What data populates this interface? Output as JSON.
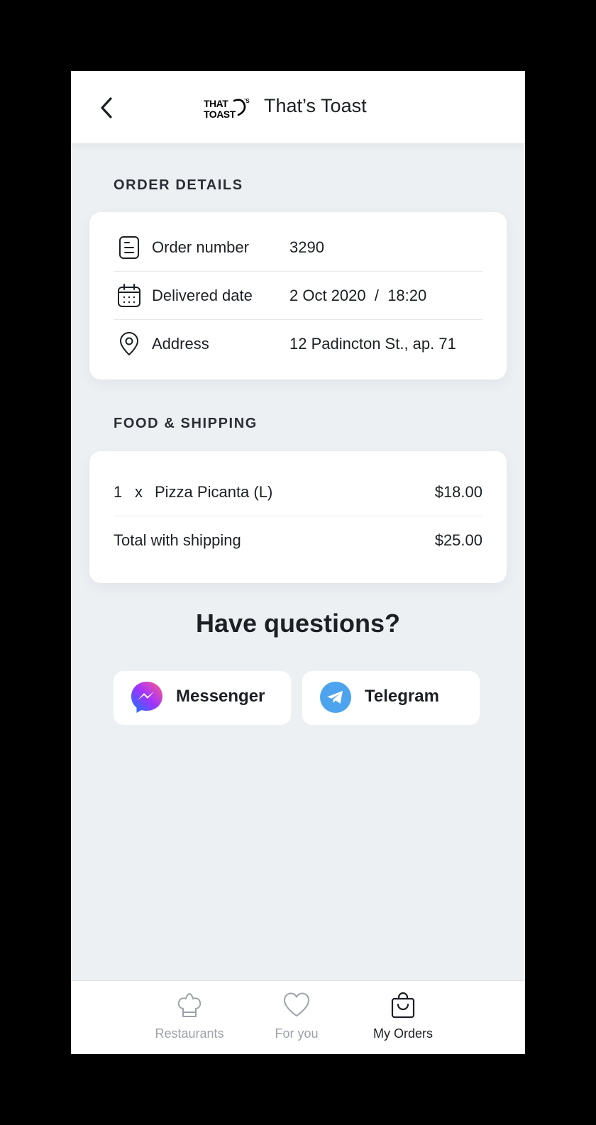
{
  "header": {
    "back_icon": "chevron-left-icon",
    "logo_text": "THAT'S TOAST",
    "title": "That’s Toast"
  },
  "order_details": {
    "section_title": "ORDER DETAILS",
    "rows": [
      {
        "icon": "receipt-icon",
        "label": "Order number",
        "value": "3290"
      },
      {
        "icon": "calendar-icon",
        "label": "Delivered date",
        "value": "2 Oct 2020  /  18:20"
      },
      {
        "icon": "location-pin-icon",
        "label": "Address",
        "value": "12 Padincton St., ap. 71"
      }
    ]
  },
  "food_shipping": {
    "section_title": "FOOD & SHIPPING",
    "items": [
      {
        "qty": "1",
        "x": "x",
        "name": "Pizza Picanta (L)",
        "price": "$18.00"
      }
    ],
    "total_label": "Total with shipping",
    "total_value": "$25.00"
  },
  "questions": {
    "title": "Have questions?",
    "buttons": [
      {
        "icon": "messenger-icon",
        "label": "Messenger"
      },
      {
        "icon": "telegram-icon",
        "label": "Telegram"
      }
    ]
  },
  "tabbar": {
    "tabs": [
      {
        "icon": "chef-hat-icon",
        "label": "Restaurants",
        "active": false
      },
      {
        "icon": "heart-icon",
        "label": "For you",
        "active": false
      },
      {
        "icon": "shopping-bag-icon",
        "label": "My Orders",
        "active": true
      }
    ]
  },
  "colors": {
    "background": "#edf0f3",
    "card": "#ffffff",
    "text": "#1c1f24",
    "muted": "#9da2a8",
    "telegram": "#4da3ee"
  }
}
